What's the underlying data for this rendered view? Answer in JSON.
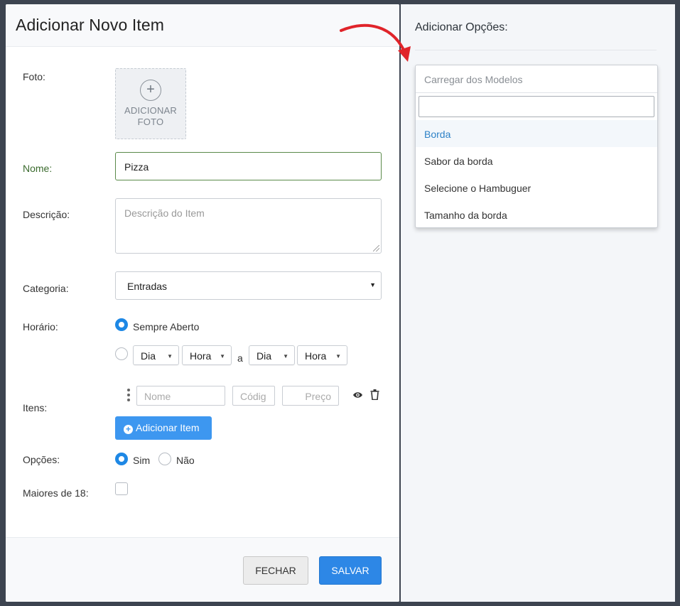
{
  "modal": {
    "title": "Adicionar Novo Item",
    "labels": {
      "photo": "Foto:",
      "name": "Nome:",
      "description": "Descrição:",
      "category": "Categoria:",
      "schedule": "Horário:",
      "items": "Itens:",
      "options": "Opções:",
      "adults": "Maiores de 18:"
    },
    "photo_add": {
      "line1": "ADICIONAR",
      "line2": "FOTO",
      "icon": "plus-circle-icon"
    },
    "name_value": "Pizza",
    "description_placeholder": "Descrição do Item",
    "category_value": "Entradas",
    "schedule": {
      "always_open_label": "Sempre Aberto",
      "always_open_checked": true,
      "from_day": "Dia",
      "from_hour": "Hora",
      "between": "a",
      "to_day": "Dia",
      "to_hour": "Hora"
    },
    "item_row": {
      "name_placeholder": "Nome",
      "code_placeholder": "Códig",
      "price_placeholder": "Preço",
      "view_icon": "eye-icon",
      "delete_icon": "trash-icon"
    },
    "add_item_label": "Adicionar Item",
    "options": {
      "yes": "Sim",
      "no": "Não",
      "selected": "yes"
    },
    "adults_checked": false,
    "footer": {
      "close_label": "FECHAR",
      "save_label": "SALVAR"
    }
  },
  "panel": {
    "title": "Adicionar Opções:",
    "dropdown": {
      "placeholder": "Carregar dos Modelos",
      "search_value": "",
      "options": [
        "Borda",
        "Sabor da borda",
        "Selecione o Hambuguer",
        "Tamanho da borda"
      ],
      "highlighted": "Borda"
    }
  },
  "colors": {
    "primary": "#2d87e6",
    "valid": "#3b6b2e",
    "highlight_text": "#2e82c7",
    "annotation_arrow": "#e0242a"
  }
}
